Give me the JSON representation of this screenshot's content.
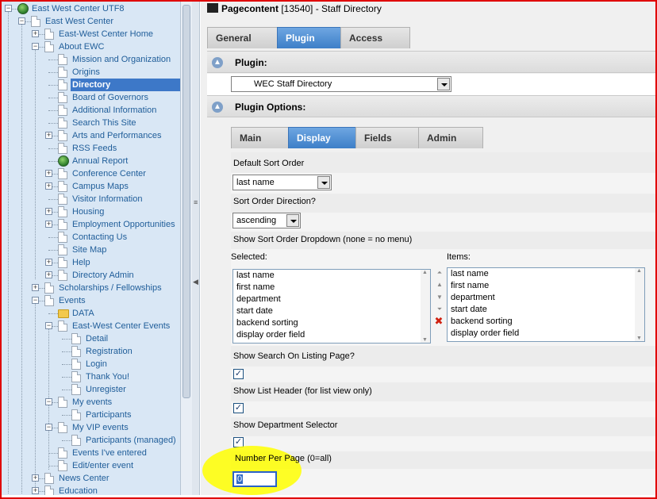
{
  "tree": {
    "items": [
      {
        "label": "East West Center UTF8",
        "icon": "globe-icon",
        "level": 0,
        "toggle": "-"
      },
      {
        "label": "East West Center",
        "icon": "page-icon",
        "level": 1,
        "toggle": "-"
      },
      {
        "label": "East-West Center Home",
        "icon": "page-icon",
        "level": 2,
        "toggle": "+"
      },
      {
        "label": "About EWC",
        "icon": "page-icon",
        "level": 2,
        "toggle": "-"
      },
      {
        "label": "Mission and Organization",
        "icon": "page-icon",
        "level": 3,
        "toggle": ""
      },
      {
        "label": "Origins",
        "icon": "page-icon",
        "level": 3,
        "toggle": ""
      },
      {
        "label": "Directory",
        "icon": "page-icon",
        "level": 3,
        "toggle": "",
        "selected": true
      },
      {
        "label": "Board of Governors",
        "icon": "page-icon",
        "level": 3,
        "toggle": ""
      },
      {
        "label": "Additional Information",
        "icon": "page-icon",
        "level": 3,
        "toggle": ""
      },
      {
        "label": "Search This Site",
        "icon": "page-icon",
        "level": 3,
        "toggle": ""
      },
      {
        "label": "Arts and Performances",
        "icon": "page-icon",
        "level": 3,
        "toggle": "+"
      },
      {
        "label": "RSS Feeds",
        "icon": "page-icon",
        "level": 3,
        "toggle": ""
      },
      {
        "label": "Annual Report",
        "icon": "globe-icon",
        "level": 3,
        "toggle": ""
      },
      {
        "label": "Conference Center",
        "icon": "page-icon",
        "level": 3,
        "toggle": "+"
      },
      {
        "label": "Campus Maps",
        "icon": "page-icon",
        "level": 3,
        "toggle": "+"
      },
      {
        "label": "Visitor Information",
        "icon": "page-icon",
        "level": 3,
        "toggle": ""
      },
      {
        "label": "Housing",
        "icon": "page-icon",
        "level": 3,
        "toggle": "+"
      },
      {
        "label": "Employment Opportunities",
        "icon": "page-icon",
        "level": 3,
        "toggle": "+"
      },
      {
        "label": "Contacting Us",
        "icon": "page-icon",
        "level": 3,
        "toggle": ""
      },
      {
        "label": "Site Map",
        "icon": "page-icon",
        "level": 3,
        "toggle": ""
      },
      {
        "label": "Help",
        "icon": "page-icon",
        "level": 3,
        "toggle": "+"
      },
      {
        "label": "Directory Admin",
        "icon": "page-icon",
        "level": 3,
        "toggle": "+"
      },
      {
        "label": "Scholarships / Fellowships",
        "icon": "page-icon",
        "level": 2,
        "toggle": "+"
      },
      {
        "label": "Events",
        "icon": "page-icon",
        "level": 2,
        "toggle": "-"
      },
      {
        "label": "DATA",
        "icon": "folder-icon",
        "level": 3,
        "toggle": ""
      },
      {
        "label": "East-West Center Events",
        "icon": "page-icon",
        "level": 3,
        "toggle": "-"
      },
      {
        "label": "Detail",
        "icon": "page-icon",
        "level": 4,
        "toggle": ""
      },
      {
        "label": "Registration",
        "icon": "page-icon",
        "level": 4,
        "toggle": ""
      },
      {
        "label": "Login",
        "icon": "page-icon",
        "level": 4,
        "toggle": ""
      },
      {
        "label": "Thank You!",
        "icon": "page-icon",
        "level": 4,
        "toggle": ""
      },
      {
        "label": "Unregister",
        "icon": "page-icon",
        "level": 4,
        "toggle": ""
      },
      {
        "label": "My events",
        "icon": "page-icon",
        "level": 3,
        "toggle": "-"
      },
      {
        "label": "Participants",
        "icon": "page-icon",
        "level": 4,
        "toggle": ""
      },
      {
        "label": "My VIP events",
        "icon": "page-icon",
        "level": 3,
        "toggle": "-"
      },
      {
        "label": "Participants (managed)",
        "icon": "page-icon",
        "level": 4,
        "toggle": ""
      },
      {
        "label": "Events I've entered",
        "icon": "page-icon",
        "level": 3,
        "toggle": ""
      },
      {
        "label": "Edit/enter event",
        "icon": "page-icon",
        "level": 3,
        "toggle": ""
      },
      {
        "label": "News Center",
        "icon": "page-icon",
        "level": 2,
        "toggle": "+"
      },
      {
        "label": "Education",
        "icon": "page-icon",
        "level": 2,
        "toggle": "+"
      }
    ]
  },
  "header": {
    "title_bold": "Pagecontent",
    "title_rest": " [13540] - Staff Directory"
  },
  "top_tabs": [
    {
      "label": "General",
      "active": false
    },
    {
      "label": "Plugin",
      "active": true
    },
    {
      "label": "Access",
      "active": false
    }
  ],
  "plugin_section": {
    "title": "Plugin:",
    "selected": "WEC Staff Directory"
  },
  "options_section": {
    "title": "Plugin Options:"
  },
  "option_tabs": [
    {
      "label": "Main",
      "active": false
    },
    {
      "label": "Display",
      "active": true
    },
    {
      "label": "Fields",
      "active": false
    },
    {
      "label": "Admin",
      "active": false
    }
  ],
  "display": {
    "default_sort_label": "Default Sort Order",
    "default_sort_value": "last name",
    "sort_direction_label": "Sort Order Direction?",
    "sort_direction_value": "ascending",
    "sort_dropdown_label": "Show Sort Order Dropdown (none = no menu)",
    "selected_label": "Selected:",
    "items_label": "Items:",
    "selected_options": [
      "last name",
      "first name",
      "department",
      "start date",
      "backend sorting",
      "display order field"
    ],
    "item_options": [
      "last name",
      "first name",
      "department",
      "start date",
      "backend sorting",
      "display order field"
    ],
    "show_search_label": "Show Search On Listing Page?",
    "show_search_checked": "✓",
    "show_list_header_label": "Show List Header (for list view only)",
    "show_list_header_checked": "✓",
    "show_dept_selector_label": "Show Department Selector",
    "show_dept_selector_checked": "✓",
    "number_per_page_label": "Number Per Page (0=all)",
    "number_per_page_value": "0"
  },
  "colors": {
    "accent": "#3d7fc8",
    "tree_bg": "#d9e7f5",
    "highlight": "#ffff00",
    "frame": "#e00000"
  }
}
